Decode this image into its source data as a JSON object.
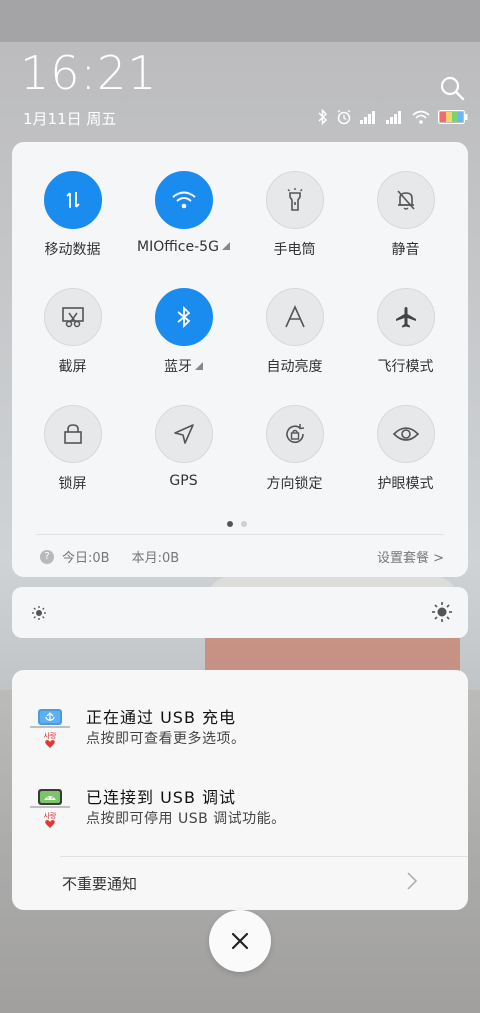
{
  "status": {
    "time": "16:21",
    "date": "1月11日 周五"
  },
  "quick_settings": {
    "tiles": [
      {
        "label": "移动数据",
        "icon": "mobile-data-icon",
        "on": true
      },
      {
        "label": "MIOffice-5G",
        "icon": "wifi-icon",
        "on": true,
        "expand": true
      },
      {
        "label": "手电筒",
        "icon": "flashlight-icon",
        "on": false
      },
      {
        "label": "静音",
        "icon": "mute-bell-icon",
        "on": false
      },
      {
        "label": "截屏",
        "icon": "screenshot-icon",
        "on": false
      },
      {
        "label": "蓝牙",
        "icon": "bluetooth-icon",
        "on": true,
        "expand": true
      },
      {
        "label": "自动亮度",
        "icon": "auto-brightness-icon",
        "on": false
      },
      {
        "label": "飞行模式",
        "icon": "airplane-icon",
        "on": false
      },
      {
        "label": "锁屏",
        "icon": "lock-icon",
        "on": false
      },
      {
        "label": "GPS",
        "icon": "gps-icon",
        "on": false
      },
      {
        "label": "方向锁定",
        "icon": "rotation-lock-icon",
        "on": false
      },
      {
        "label": "护眼模式",
        "icon": "eye-icon",
        "on": false
      }
    ],
    "usage_today": "今日:0B",
    "usage_month": "本月:0B",
    "settings_link": "设置套餐 >"
  },
  "notifications": [
    {
      "title": "正在通过 USB 充电",
      "subtitle": "点按即可查看更多选项。",
      "icon": "usb-icon"
    },
    {
      "title": "已连接到 USB 调试",
      "subtitle": "点按即可停用 USB 调试功能。",
      "icon": "android-debug-icon"
    }
  ],
  "minor_notifications_label": "不重要通知",
  "colors": {
    "accent": "#1a8cf0",
    "card_bg": "#f5f6f7"
  }
}
